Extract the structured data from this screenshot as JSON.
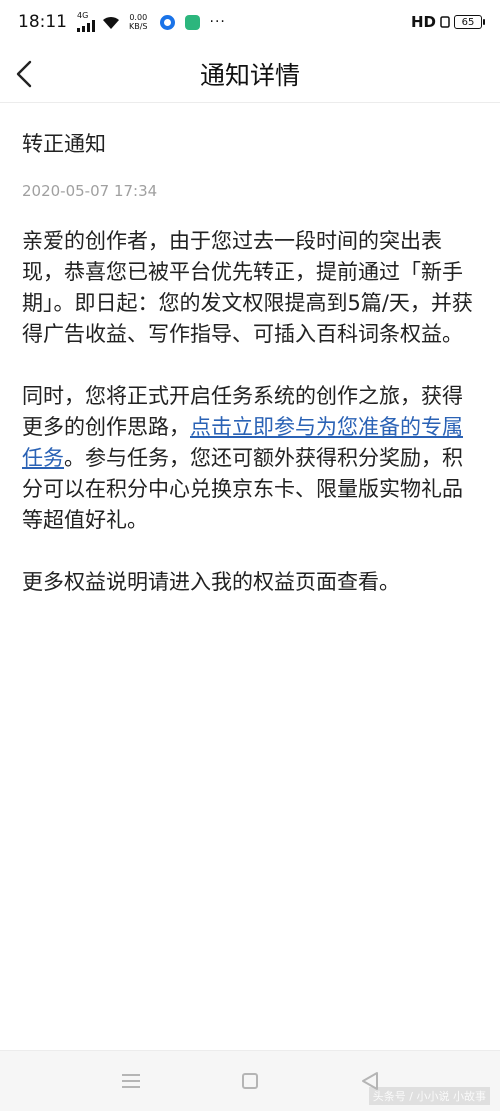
{
  "status_bar": {
    "time": "18:11",
    "network": "4G",
    "net_speed_value": "0.00",
    "net_speed_unit": "KB/S",
    "dots": "···",
    "hd": "HD",
    "battery": "65"
  },
  "header": {
    "title": "通知详情",
    "back_icon": "chevron-left-icon"
  },
  "notice": {
    "title": "转正通知",
    "time": "2020-05-07 17:34",
    "paragraph1": "亲爱的创作者，由于您过去一段时间的突出表现，恭喜您已被平台优先转正，提前通过「新手期」。即日起：您的发文权限提高到5篇/天，并获得广告收益、写作指导、可插入百科词条权益。",
    "paragraph2_before": "同时，您将正式开启任务系统的创作之旅，获得更多的创作思路，",
    "paragraph2_link": "点击立即参与为您准备的专属任务",
    "paragraph2_after": "。参与任务，您还可额外获得积分奖励，积分可以在积分中心兑换京东卡、限量版实物礼品等超值好礼。",
    "paragraph3": "更多权益说明请进入我的权益页面查看。"
  },
  "nav_bar": {
    "menu_icon": "menu-icon",
    "home_icon": "square-home-icon",
    "back_icon": "triangle-back-icon",
    "watermark": "头条号 / 小小说 小故事"
  },
  "colors": {
    "link": "#2a62b5",
    "timestamp": "#a0a0a0",
    "text": "#222222"
  }
}
